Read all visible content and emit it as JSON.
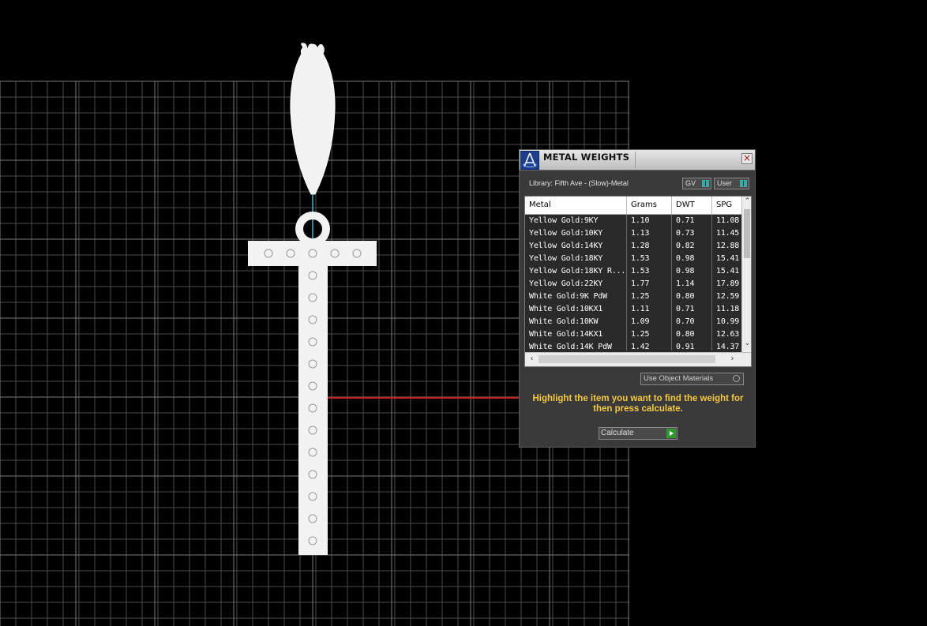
{
  "window": {
    "title": "METAL WEIGHTS",
    "close_label": "×"
  },
  "library": {
    "label": "Library: Fifth Ave - (Slow)-Metal"
  },
  "toggles": {
    "gv": "GV",
    "user": "User"
  },
  "table": {
    "columns": [
      "Metal",
      "Grams",
      "DWT",
      "SPG"
    ],
    "rows": [
      [
        "Yellow Gold:9KY",
        "1.10",
        "0.71",
        "11.08"
      ],
      [
        "Yellow Gold:10KY",
        "1.13",
        "0.73",
        "11.45"
      ],
      [
        "Yellow Gold:14KY",
        "1.28",
        "0.82",
        "12.88"
      ],
      [
        "Yellow Gold:18KY",
        "1.53",
        "0.98",
        "15.41"
      ],
      [
        "Yellow Gold:18KY R...",
        "1.53",
        "0.98",
        "15.41"
      ],
      [
        "Yellow Gold:22KY",
        "1.77",
        "1.14",
        "17.89"
      ],
      [
        "White Gold:9K PdW",
        "1.25",
        "0.80",
        "12.59"
      ],
      [
        "White Gold:10KX1",
        "1.11",
        "0.71",
        "11.18"
      ],
      [
        "White Gold:10KW",
        "1.09",
        "0.70",
        "10.99"
      ],
      [
        "White Gold:14KX1",
        "1.25",
        "0.80",
        "12.63"
      ],
      [
        "White Gold:14K PdW",
        "1.42",
        "0.91",
        "14.37"
      ]
    ]
  },
  "options": {
    "use_object_materials": "Use Object Materials"
  },
  "hint": "Highlight the item you want to find the weight for then press calculate.",
  "calculate_label": "Calculate",
  "colors": {
    "hint": "#f5c842",
    "axis_red": "#c8201a",
    "axis_cyan": "#3fb6c4",
    "grid": "#5a5a5a"
  }
}
